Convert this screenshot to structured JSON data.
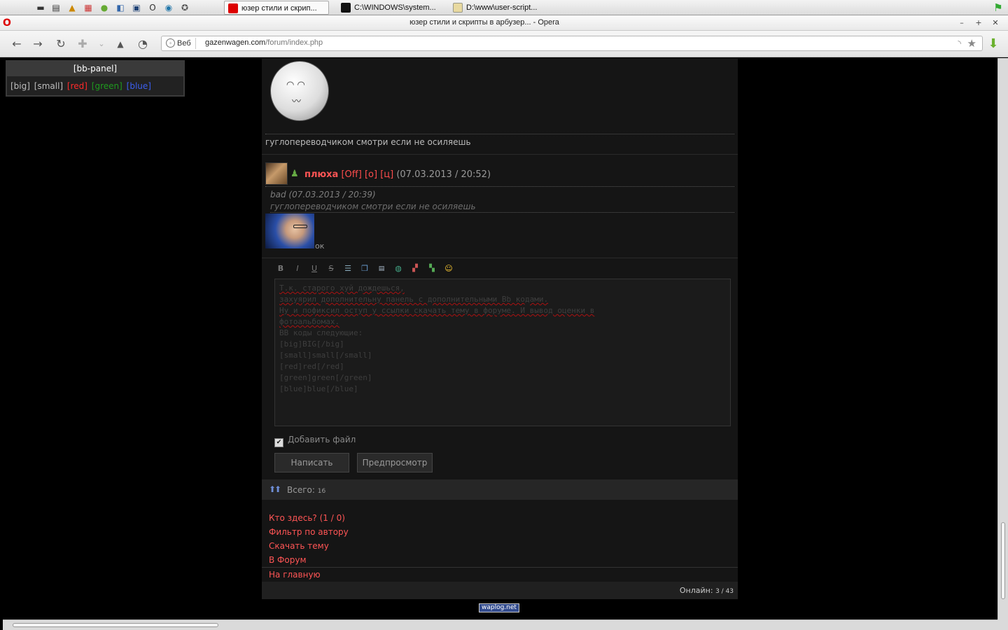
{
  "taskbar": {
    "quicklaunch_icons": [
      "folder-icon",
      "clapperboard-icon",
      "warning-app-icon",
      "calendar-app-icon",
      "plugin-app-icon",
      "notepad-app-icon",
      "monitor-icon",
      "opera-icon",
      "browser-icon",
      "compass-icon"
    ],
    "tasks": [
      {
        "label": "юзер стили и скрип...",
        "active": true
      },
      {
        "label": "C:\\WINDOWS\\system...",
        "active": false
      },
      {
        "label": "D:\\www\\user-script...",
        "active": false
      }
    ]
  },
  "titlebar": {
    "title": "юзер стили и скрипты в арбузер... - Opera"
  },
  "navbar": {
    "badge_label": "Веб",
    "url_domain": "gazenwagen.com",
    "url_path": "/forum/index.php"
  },
  "bb_panel": {
    "title": "[bb-panel]",
    "buttons": [
      {
        "label": "[big]",
        "color": "#bdbdbd"
      },
      {
        "label": "[small]",
        "color": "#bdbdbd"
      },
      {
        "label": "[red]",
        "color": "#ff2a2a"
      },
      {
        "label": "[green]",
        "color": "#1f9a1f"
      },
      {
        "label": "[blue]",
        "color": "#3b5ff0"
      }
    ]
  },
  "post_prev": {
    "text": "гуглопереводчиком смотри если не осиляешь"
  },
  "post": {
    "author": "плюха",
    "status": "[Off]",
    "btn_o": "[о]",
    "btn_c": "[ц]",
    "date": "(07.03.2013 / 20:52)",
    "quote_author": "bad (07.03.2013 / 20:39)",
    "quote_text": "гуглопереводчиком смотри если не осиляешь",
    "body": "ок"
  },
  "editor": {
    "toolbar": [
      "bold-icon",
      "italic-icon",
      "underline-icon",
      "strike-icon",
      "list-icon",
      "copy-icon",
      "code-icon",
      "link-icon",
      "color-icon",
      "color2-icon",
      "smiley-icon"
    ],
    "message_lines": [
      "Т.к. старого хуй дождешься,",
      "захуярил дополнительну панель с дополнительными Bb кодами.",
      "Ну и пофиксил оступ у ссылки скачать тему в форуме. И вывод оценки в",
      "фотоальбомах.",
      "BB коды следующие:",
      "[big]BIG[/big]",
      "[small]small[/small]",
      "[red]red[/red]",
      "[green]green[/green]",
      "[blue]blue[/blue]"
    ],
    "attach_label": "Добавить файл",
    "submit_label": "Написать",
    "preview_label": "Предпросмотр"
  },
  "footer": {
    "total_label": "Всего:",
    "total_value": "16",
    "who_here": "Кто здесь?",
    "who_here_count": "(1 / 0)",
    "filter_author": "Фильтр по автору",
    "download_topic": "Скачать тему",
    "to_forum": "В Форум",
    "home": "На главную",
    "online_label": "Онлайн:",
    "online_value": "3 / 43",
    "counter_label": "waplog.net"
  }
}
